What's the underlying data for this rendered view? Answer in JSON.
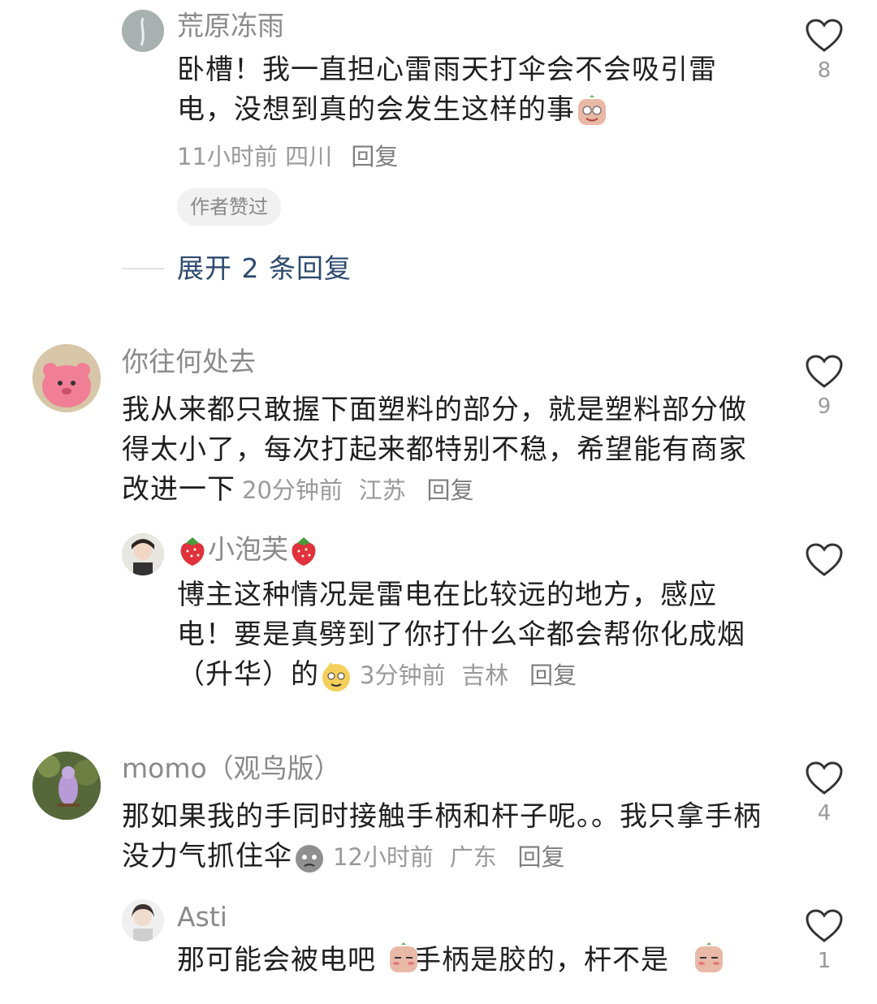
{
  "comments": [
    {
      "username": "荒原冻雨",
      "text": "卧槽！我一直担心雷雨天打伞会不会吸引雷电，没想到真的会发生这样的事",
      "meta_time": "11小时前",
      "meta_location": "四川",
      "reply_label": "回复",
      "badge": "作者赞过",
      "expand_label": "展开 2 条回复",
      "likes": "8"
    },
    {
      "username": "你往何处去",
      "text": "我从来都只敢握下面塑料的部分，就是塑料部分做得太小了，每次打起来都特别不稳，希望能有商家改进一下",
      "meta_time": "20分钟前",
      "meta_location": "江苏",
      "reply_label": "回复",
      "likes": "9"
    },
    {
      "username": "小泡芙",
      "text": "博主这种情况是雷电在比较远的地方，感应电！要是真劈到了你打什么伞都会帮你化成烟（升华）的",
      "meta_time": "3分钟前",
      "meta_location": "吉林",
      "reply_label": "回复",
      "likes": ""
    },
    {
      "username": "momo（观鸟版）",
      "text": "那如果我的手同时接触手柄和杆子呢。。我只拿手柄没力气抓住伞",
      "meta_time": "12小时前",
      "meta_location": "广东",
      "reply_label": "回复",
      "likes": "4"
    },
    {
      "username": "Asti",
      "text": "那可能会被电吧手柄是胶的，杆不是",
      "likes": "1"
    }
  ],
  "colors": {
    "username": "#8a8a8a",
    "meta": "#9a9a9a",
    "expand": "#2d4a6e"
  },
  "icons": {
    "like": "heart-outline-icon"
  }
}
